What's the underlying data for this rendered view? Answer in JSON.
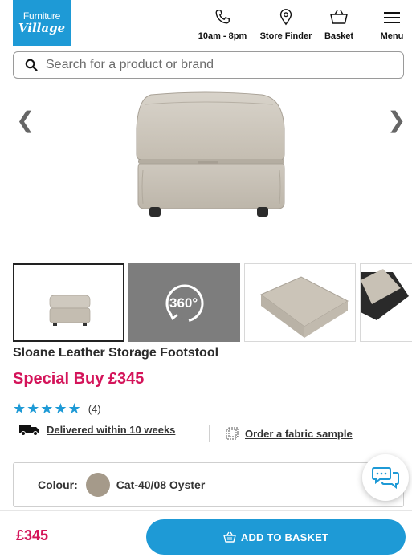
{
  "header": {
    "logo_line1": "Furniture",
    "logo_line2": "Village",
    "nav": [
      {
        "label": "10am - 8pm",
        "icon": "phone-icon"
      },
      {
        "label": "Store Finder",
        "icon": "location-pin-icon"
      },
      {
        "label": "Basket",
        "icon": "basket-icon"
      },
      {
        "label": "Menu",
        "icon": "menu-icon"
      }
    ]
  },
  "search": {
    "placeholder": "Search for a product or brand"
  },
  "gallery": {
    "prev_icon": "chevron-left-icon",
    "next_icon": "chevron-right-icon",
    "thumbs_360_label": "360°"
  },
  "product": {
    "title": "Sloane Leather Storage Footstool",
    "price": "Special Buy £345",
    "rating_stars": "★★★★★",
    "rating_count": "(4)",
    "rating_value": 5,
    "delivery": "Delivered within 10 weeks",
    "sample_link": "Order a fabric sample",
    "colour_label": "Colour:",
    "colour_value": "Cat-40/08 Oyster"
  },
  "footer": {
    "price": "£345",
    "add_to_basket": "ADD TO BASKET"
  },
  "colors": {
    "brand_blue": "#1e9ad6",
    "price_pink": "#d4145a",
    "swatch": "#a59a8a"
  }
}
